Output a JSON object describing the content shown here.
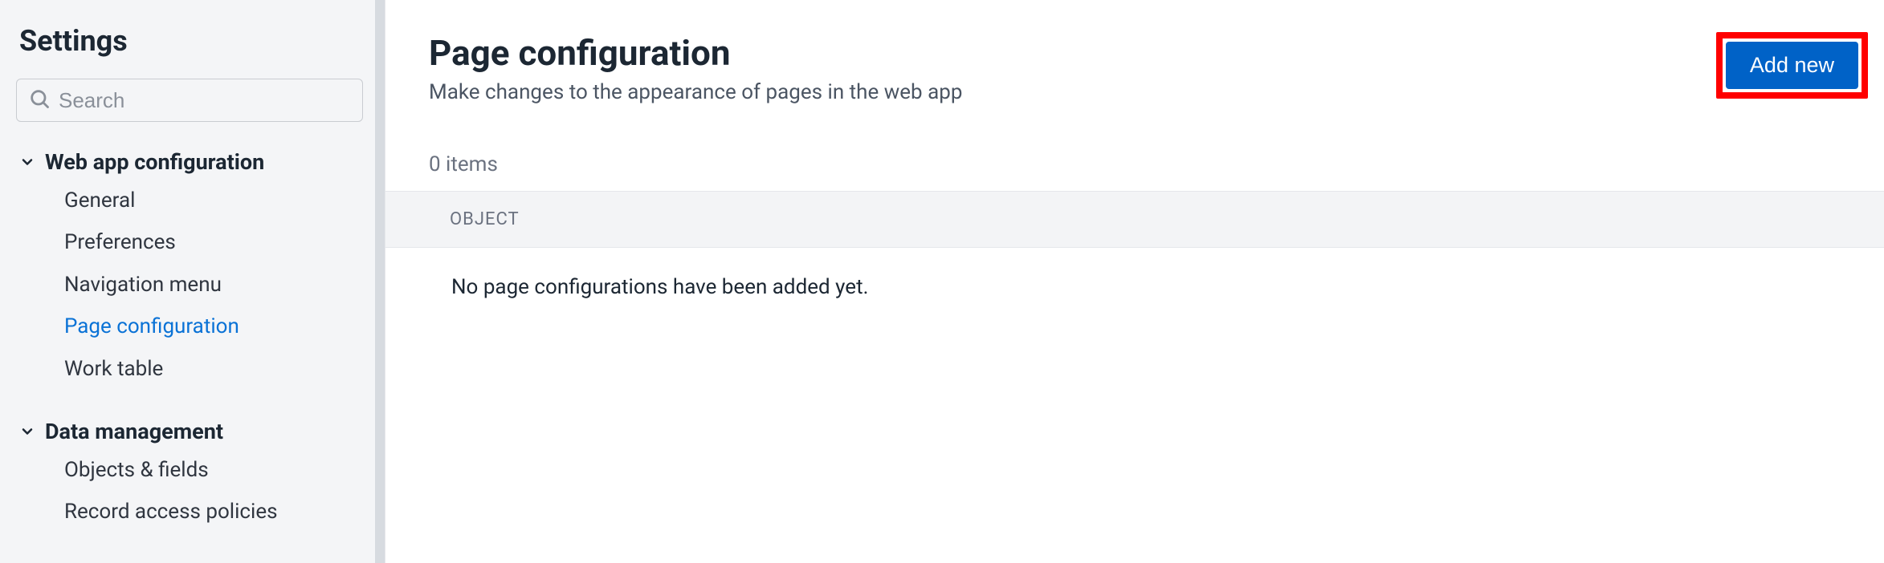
{
  "sidebar": {
    "title": "Settings",
    "search_placeholder": "Search",
    "groups": [
      {
        "label": "Web app configuration",
        "items": [
          {
            "label": "General",
            "active": false
          },
          {
            "label": "Preferences",
            "active": false
          },
          {
            "label": "Navigation menu",
            "active": false
          },
          {
            "label": "Page configuration",
            "active": true
          },
          {
            "label": "Work table",
            "active": false
          }
        ]
      },
      {
        "label": "Data management",
        "items": [
          {
            "label": "Objects & fields",
            "active": false
          },
          {
            "label": "Record access policies",
            "active": false
          }
        ]
      }
    ]
  },
  "main": {
    "title": "Page configuration",
    "subtitle": "Make changes to the appearance of pages in the web app",
    "add_button": "Add new",
    "item_count": "0 items",
    "table_header": "OBJECT",
    "empty_message": "No page configurations have been added yet."
  }
}
